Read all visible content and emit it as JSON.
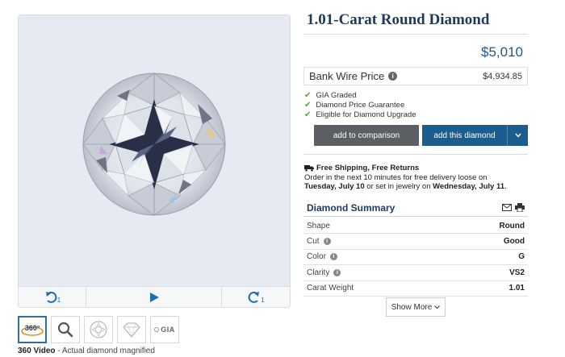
{
  "viewer": {
    "controls": {
      "rotate_left_sub": "1",
      "rotate_right_sub": "1"
    },
    "thumbnails": [
      {
        "name": "360-video",
        "label": "360°"
      },
      {
        "name": "magnifier",
        "label": ""
      },
      {
        "name": "diamond-plot",
        "label": ""
      },
      {
        "name": "diamond-profile",
        "label": ""
      },
      {
        "name": "gia-certificate",
        "label": "GIA"
      }
    ],
    "caption": {
      "bold": "360 Video",
      "rest": " - Actual diamond magnified"
    }
  },
  "product": {
    "title": "1.01-Carat Round Diamond",
    "price": "$5,010",
    "bank_wire": {
      "label": "Bank Wire Price",
      "value": "$4,934.85"
    },
    "features": [
      "GIA Graded",
      "Diamond Price Guarantee",
      "Eligible for Diamond Upgrade"
    ],
    "buttons": {
      "compare": "add to comparison",
      "add": "add this diamond"
    }
  },
  "shipping": {
    "heading": "Free Shipping, Free Returns",
    "line1": "Order in the next 10 minutes for free delivery loose on",
    "date_loose": "Tuesday, July 10",
    "mid": " or set in jewelry on ",
    "date_jewelry": "Wednesday, July 11",
    "end": "."
  },
  "summary": {
    "title": "Diamond Summary",
    "rows": [
      {
        "label": "Shape",
        "value": "Round",
        "info": false
      },
      {
        "label": "Cut",
        "value": "Good",
        "info": true
      },
      {
        "label": "Color",
        "value": "G",
        "info": true
      },
      {
        "label": "Clarity",
        "value": "VS2",
        "info": true
      },
      {
        "label": "Carat Weight",
        "value": "1.01",
        "info": false
      }
    ],
    "show_more": "Show More"
  },
  "colors": {
    "brand_navy": "#1d3a5c",
    "accent_blue": "#1b5d8e",
    "check_green": "#5aa52f",
    "compare_gray": "#5b5e62"
  }
}
